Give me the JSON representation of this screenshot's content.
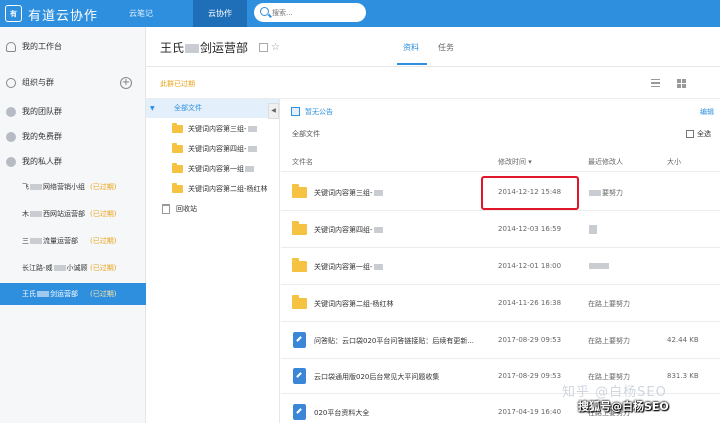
{
  "topbar": {
    "logo_text": "有",
    "app_title": "有道云协作",
    "tabs": [
      "云笔记",
      "云协作"
    ],
    "search_placeholder": "搜索..."
  },
  "sidebar": {
    "workbench": "我的工作台",
    "org_groups": "组织与群",
    "add_symbol": "+",
    "sections": [
      "我的团队群",
      "我的免费群",
      "我的私人群"
    ],
    "groups": [
      {
        "name_a": "飞",
        "name_b": "网络营销小组",
        "status": "(已过期)"
      },
      {
        "name_a": "木",
        "name_b": "西网站运营部",
        "status": "(已过期)"
      },
      {
        "name_a": "三",
        "name_b": "流量运营部",
        "status": "(已过期)"
      },
      {
        "name_a": "长江路-威",
        "name_b": "小诚顾",
        "status": "(已过期)"
      },
      {
        "name_a": "王氏",
        "name_b": "剑运营部",
        "status": "(已过期)"
      }
    ]
  },
  "main": {
    "group_title_a": "王氏",
    "group_title_b": "剑运营部",
    "tabs": [
      "资料",
      "任务"
    ],
    "expired_notice": "此群已过期",
    "announcement": "暂无公告",
    "edit": "编辑",
    "breadcrumb": "全部文件",
    "select_all": "全选"
  },
  "tree": {
    "root": "全部文件",
    "folders": [
      "关键词内容第三组-",
      "关键词内容第四组-",
      "关键词内容第一组",
      "关键词内容第二组-杨红林"
    ],
    "trash": "回收站",
    "collapse": "◀"
  },
  "table": {
    "headers": {
      "name": "文件名",
      "modified": "修改时间 ▾",
      "modifier": "最近修改人",
      "size": "大小"
    },
    "rows": [
      {
        "type": "folder",
        "name": "关键词内容第三组-",
        "time": "2014-12-12 15:48",
        "user": "要努力",
        "size": ""
      },
      {
        "type": "folder",
        "name": "关键词内容第四组-",
        "time": "2014-12-03 16:59",
        "user": "",
        "size": ""
      },
      {
        "type": "folder",
        "name": "关键词内容第一组-",
        "time": "2014-12-01 18:00",
        "user": "",
        "size": ""
      },
      {
        "type": "folder",
        "name": "关键词内容第二组-杨红林",
        "time": "2014-11-26 16:38",
        "user": "在路上要努力",
        "size": ""
      },
      {
        "type": "doc",
        "name": "问答贴：云口袋020平台问答链接贴：后续有更新...",
        "time": "2017-08-29 09:53",
        "user": "在路上要努力",
        "size": "42.44 KB"
      },
      {
        "type": "doc",
        "name": "云口袋通用版020后台常见大平问题收集",
        "time": "2017-08-29 09:53",
        "user": "在路上要努力",
        "size": "831.3 KB"
      },
      {
        "type": "doc",
        "name": "020平台资料大全",
        "time": "2017-04-19 16:40",
        "user": "在路上要努力",
        "size": ""
      }
    ]
  },
  "watermark": {
    "line1": "知乎 @白杨SEO",
    "line2": "搜狐号@白杨SEO"
  },
  "colors": {
    "brand": "#2d8fde",
    "expired": "#e8a317",
    "highlight": "#e0162b"
  }
}
